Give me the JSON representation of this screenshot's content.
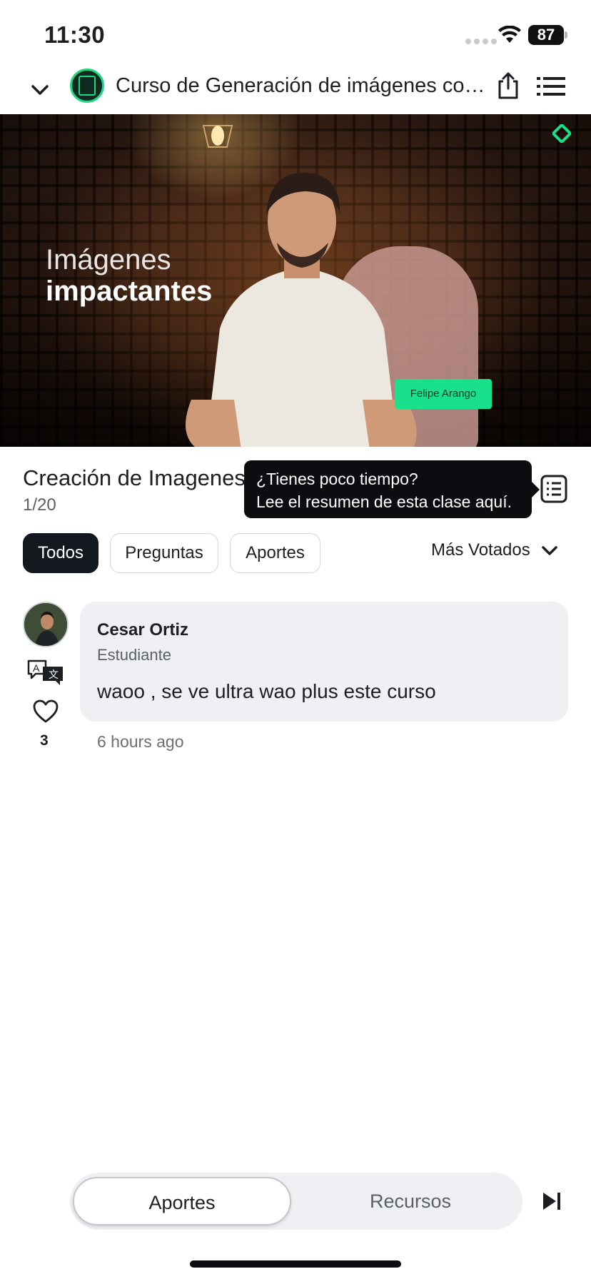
{
  "status_bar": {
    "time": "11:30",
    "battery": "87"
  },
  "header": {
    "course_title": "Curso de Generación de imágenes con...",
    "icons": [
      "chevron-down-icon",
      "course-logo-icon",
      "share-icon",
      "list-icon"
    ]
  },
  "video": {
    "overlay_line1": "Imágenes",
    "overlay_line2": "impactantes",
    "name_tag": "Felipe Arango"
  },
  "lesson": {
    "title": "Creación de Imagenes con Inteligencia Artificial",
    "counter": "1/20",
    "tooltip_line1": "¿Tienes poco tiempo?",
    "tooltip_line2": "Lee el resumen de esta clase aquí."
  },
  "filters": {
    "chips": [
      {
        "label": "Todos",
        "active": true
      },
      {
        "label": "Preguntas",
        "active": false
      },
      {
        "label": "Aportes",
        "active": false
      }
    ],
    "sort": "Más Votados"
  },
  "comments": [
    {
      "author": "Cesar Ortiz",
      "role": "Estudiante",
      "text": "waoo , se ve ultra wao plus este curso",
      "likes": "3",
      "time": "6 hours ago"
    }
  ],
  "bottom_tabs": {
    "items": [
      {
        "label": "Aportes",
        "active": true
      },
      {
        "label": "Recursos",
        "active": false
      }
    ]
  },
  "colors": {
    "accent": "#19e08a",
    "dark": "#13181e",
    "bubble": "#eef0f3"
  }
}
